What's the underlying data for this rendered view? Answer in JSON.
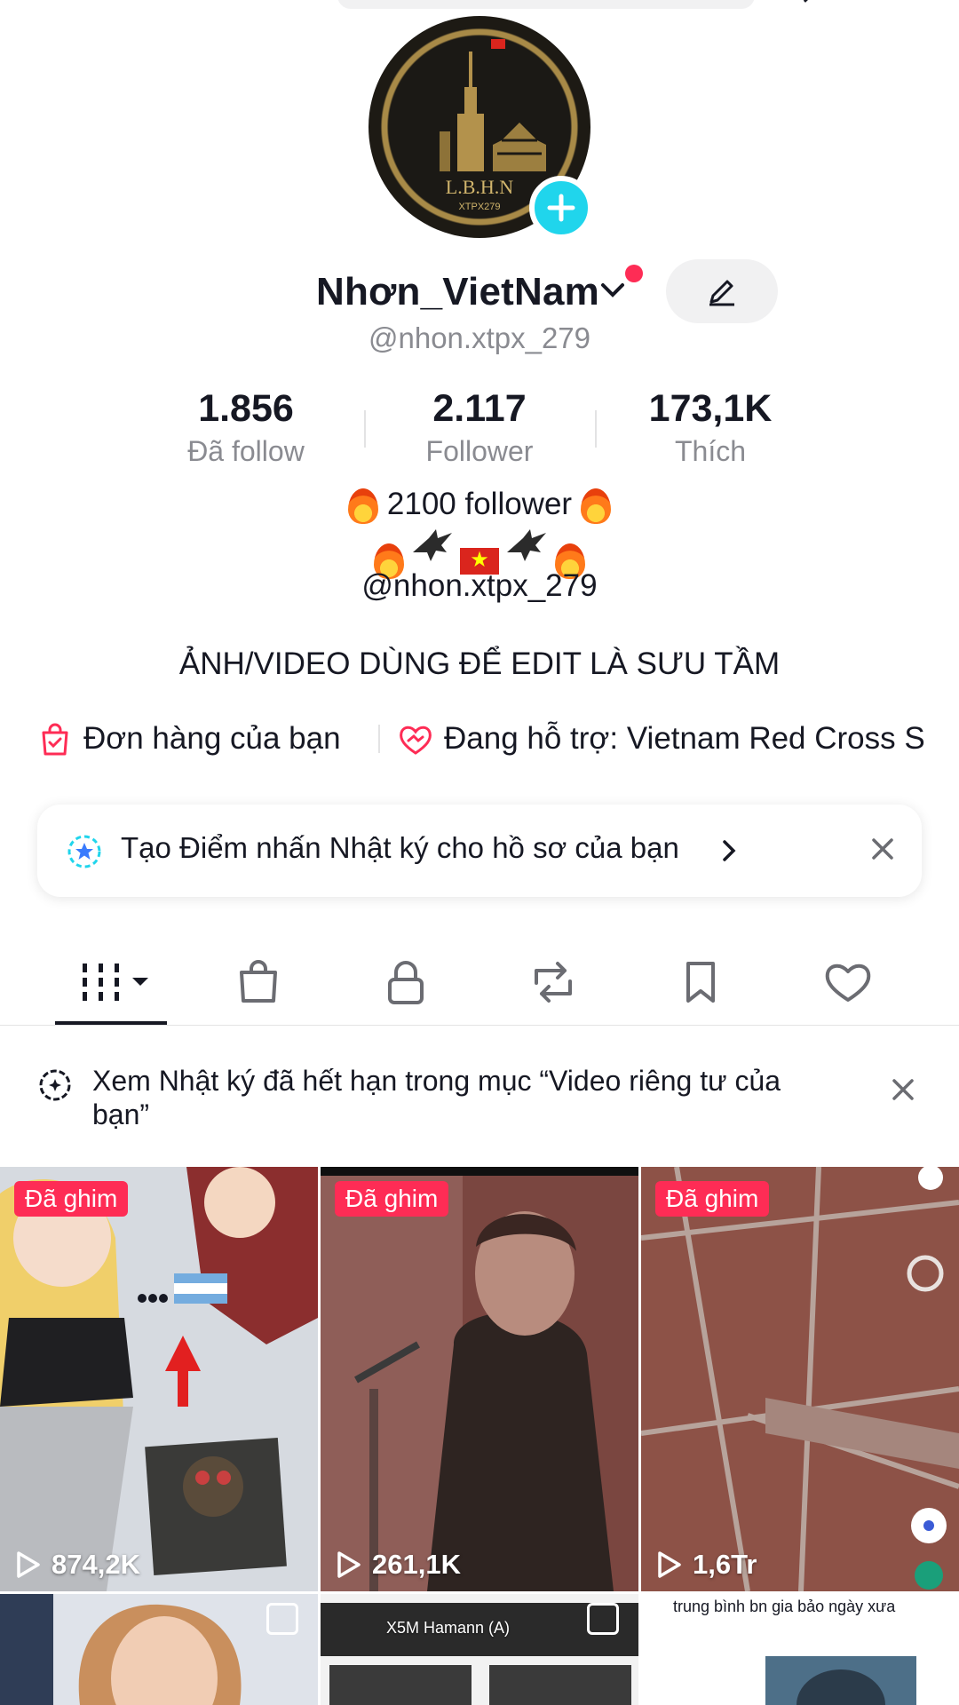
{
  "profile": {
    "display_name": "Nhơn_VietNam",
    "username": "@nhon.xtpx_279",
    "avatar_text": "L.B.H.N",
    "avatar_subtext": "XTPX279"
  },
  "stats": [
    {
      "value": "1.856",
      "label": "Đã follow"
    },
    {
      "value": "2.117",
      "label": "Follower"
    },
    {
      "value": "173,1K",
      "label": "Thích"
    }
  ],
  "bio": {
    "line1": "2100 follower",
    "line3": "@nhon.xtpx_279",
    "line4": "ẢNH/VIDEO DÙNG ĐỂ EDIT LÀ SƯU TẦM"
  },
  "links": {
    "orders": "Đơn hàng của bạn",
    "support": "Đang hỗ trợ: Vietnam Red Cross S"
  },
  "highlight_card": {
    "text": "Tạo Điểm nhấn Nhật ký cho hồ sơ của bạn"
  },
  "tabs": [
    "videos-grid",
    "shop",
    "private",
    "reposts",
    "favorites",
    "liked"
  ],
  "notice": {
    "text": "Xem Nhật ký đã hết hạn trong mục “Video riêng tư của bạn”"
  },
  "videos": [
    {
      "pinned_label": "Đã ghim",
      "views": "874,2K"
    },
    {
      "pinned_label": "Đã ghim",
      "views": "261,1K"
    },
    {
      "pinned_label": "Đã ghim",
      "views": "1,6Tr"
    }
  ],
  "next_row_captions": {
    "second": "X5M Hamann (A)",
    "third": "trung bình bn gia bảo ngày xưa"
  },
  "colors": {
    "accent_red": "#fe2c55",
    "accent_cyan": "#20d5ec",
    "text_primary": "#161823",
    "text_secondary": "#8a8b91"
  }
}
